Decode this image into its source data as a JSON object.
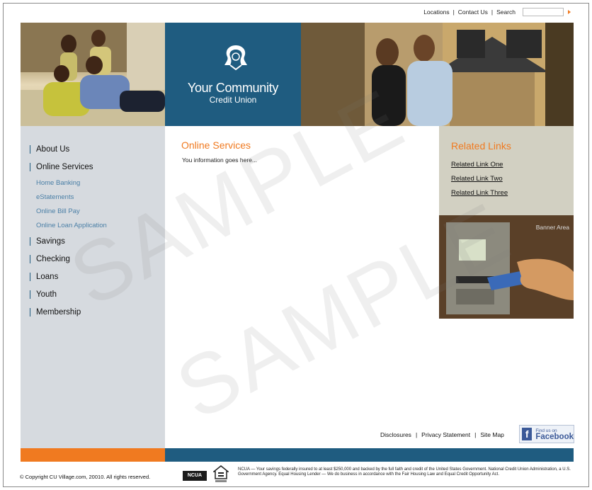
{
  "topbar": {
    "locations": "Locations",
    "contact": "Contact Us",
    "search": "Search",
    "separator": "|"
  },
  "brand": {
    "name": "Your Community",
    "subtitle": "Credit Union",
    "color": "#1f5c80"
  },
  "nav": {
    "items": [
      {
        "label": "About Us"
      },
      {
        "label": "Online Services"
      }
    ],
    "sub_items": [
      {
        "label": "Home Banking"
      },
      {
        "label": "eStatements"
      },
      {
        "label": "Online Bill Pay"
      },
      {
        "label": "Online Loan Application"
      }
    ],
    "items_after": [
      {
        "label": "Savings"
      },
      {
        "label": "Checking"
      },
      {
        "label": "Loans"
      },
      {
        "label": "Youth"
      },
      {
        "label": "Membership"
      }
    ]
  },
  "content": {
    "title": "Online Services",
    "body": "You information goes here..."
  },
  "related": {
    "title": "Related Links",
    "links": [
      {
        "label": "Related Link One"
      },
      {
        "label": "Related Link Two"
      },
      {
        "label": "Related Link Three"
      }
    ]
  },
  "banner": {
    "label": "Banner Area"
  },
  "footer": {
    "links": [
      {
        "label": "Disclosures"
      },
      {
        "label": "Privacy Statement"
      },
      {
        "label": "Site Map"
      }
    ],
    "facebook_small": "Find us on",
    "facebook_big": "Facebook",
    "copyright": "© Copyright CU Village.com, 20010. All rights reserved.",
    "ncua": "NCUA",
    "disclaimer": "NCUA — Your savings federally insured to at least $250,000 and backed by the full faith and credit of the United States Government. National Credit Union Administration, a U.S. Government Agency. Equal Housing Lender — We do business in accordance with the Fair Housing Law and Equal Credit Opportunity Act."
  },
  "watermark": "SAMPLE",
  "colors": {
    "accent_orange": "#f07a20",
    "brand_blue": "#1f5c80",
    "nav_bg": "#d6dadf",
    "related_bg": "#d2d0c2"
  }
}
